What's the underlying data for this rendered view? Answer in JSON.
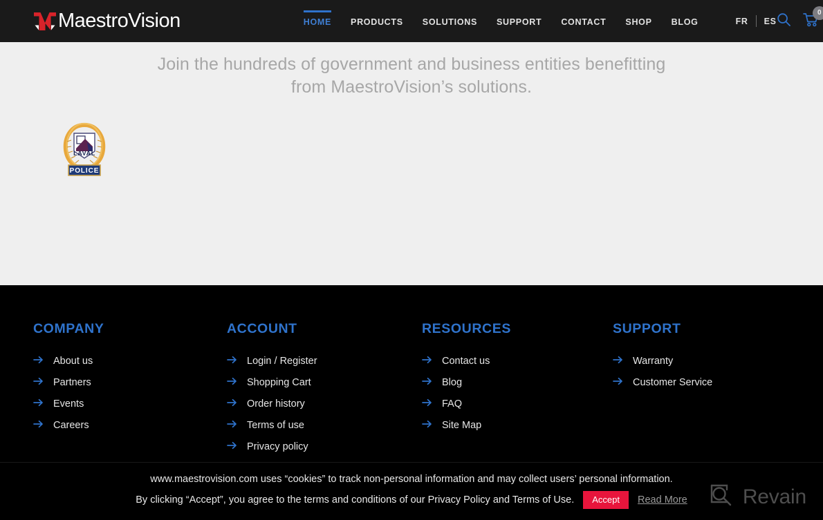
{
  "header": {
    "logo": {
      "mark_icon": "maestrovision-m-chevron-icon",
      "text": "MaestroVision",
      "mark_color": "#d8232a"
    },
    "nav": [
      {
        "label": "HOME",
        "active": true
      },
      {
        "label": "PRODUCTS",
        "active": false
      },
      {
        "label": "SOLUTIONS",
        "active": false
      },
      {
        "label": "SUPPORT",
        "active": false
      },
      {
        "label": "CONTACT",
        "active": false
      },
      {
        "label": "SHOP",
        "active": false
      },
      {
        "label": "BLOG",
        "active": false
      }
    ],
    "languages": [
      {
        "label": "FR"
      },
      {
        "label": "ES"
      }
    ],
    "icons": {
      "search": "search-icon",
      "cart": "shopping-cart-icon",
      "account": "user-account-icon"
    },
    "cart_count": "0",
    "active_accent": "#2f73cc",
    "background": "#1a1a1a"
  },
  "hero": {
    "tagline_line1": "Join the hundreds of government and business entities benefitting",
    "tagline_line2": "from MaestroVision’s solutions.",
    "tagline_color": "#a7a7a7",
    "background": "#efefef",
    "badges": [
      {
        "name": "laval-police-badge",
        "title": "LAVAL",
        "banner": "POLICE",
        "wreath_color": "#e8a83c",
        "banner_color": "#1e3a78"
      }
    ]
  },
  "footer": {
    "heading_color": "#2f73cc",
    "background": "#000000",
    "columns": [
      {
        "title": "COMPANY",
        "links": [
          {
            "label": "About us"
          },
          {
            "label": "Partners"
          },
          {
            "label": "Events"
          },
          {
            "label": "Careers"
          }
        ]
      },
      {
        "title": "ACCOUNT",
        "links": [
          {
            "label": "Login / Register"
          },
          {
            "label": "Shopping Cart"
          },
          {
            "label": "Order history"
          },
          {
            "label": "Terms of use"
          },
          {
            "label": "Privacy policy"
          }
        ]
      },
      {
        "title": "RESOURCES",
        "links": [
          {
            "label": "Contact us"
          },
          {
            "label": "Blog"
          },
          {
            "label": "FAQ"
          },
          {
            "label": "Site Map"
          }
        ]
      },
      {
        "title": "SUPPORT",
        "links": [
          {
            "label": "Warranty"
          },
          {
            "label": "Customer Service"
          }
        ]
      }
    ],
    "arrow_icon": "arrow-right-icon"
  },
  "cookie_notice": {
    "line1": "www.maestrovision.com uses “cookies” to track non-personal information and may collect users’ personal information.",
    "line2": "By clicking “Accept”, you agree to the terms and conditions of our Privacy Policy and Terms of Use.",
    "accept_label": "Accept",
    "read_more_label": "Read More",
    "accept_color": "#e8153c"
  },
  "watermark": {
    "icon": "revain-logo-icon",
    "text": "Revain",
    "color": "#4e4e4e"
  }
}
